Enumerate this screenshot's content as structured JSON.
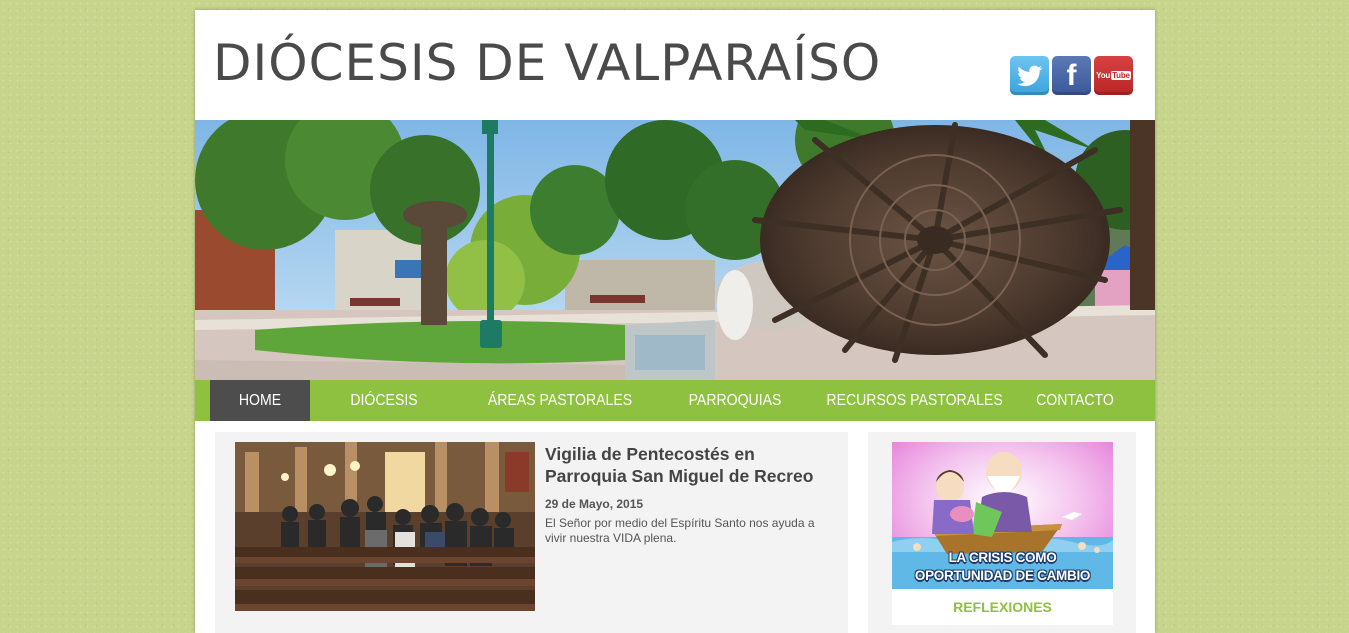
{
  "header": {
    "site_title": "DIÓCESIS DE VALPARAÍSO",
    "social": [
      {
        "name": "twitter",
        "glyph": "bird"
      },
      {
        "name": "facebook",
        "glyph": "f"
      },
      {
        "name": "youtube",
        "label_you": "You",
        "label_tube": "Tube"
      }
    ]
  },
  "nav": {
    "items": [
      {
        "label": "HOME",
        "active": true
      },
      {
        "label": "DIÓCESIS",
        "active": false
      },
      {
        "label": "ÁREAS PASTORALES",
        "active": false
      },
      {
        "label": "PARROQUIAS",
        "active": false
      },
      {
        "label": "RECURSOS PASTORALES",
        "active": false
      },
      {
        "label": "CONTACTO",
        "active": false
      }
    ]
  },
  "post": {
    "title": "Vigilia de Pentecostés en Parroquia San Miguel de Recreo",
    "date": "29 de Mayo, 2015",
    "excerpt": "El Señor por medio del Espíritu Santo nos ayuda a vivir nuestra VIDA plena."
  },
  "sidebar": {
    "banner_line1": "LA CRISIS COMO",
    "banner_line2": "OPORTUNIDAD DE CAMBIO",
    "label": "REFLEXIONES"
  },
  "colors": {
    "background": "#c7d58c",
    "nav_green": "#8dc13f",
    "nav_active": "#4d4d4d",
    "title_gray": "#4a4a4a"
  }
}
